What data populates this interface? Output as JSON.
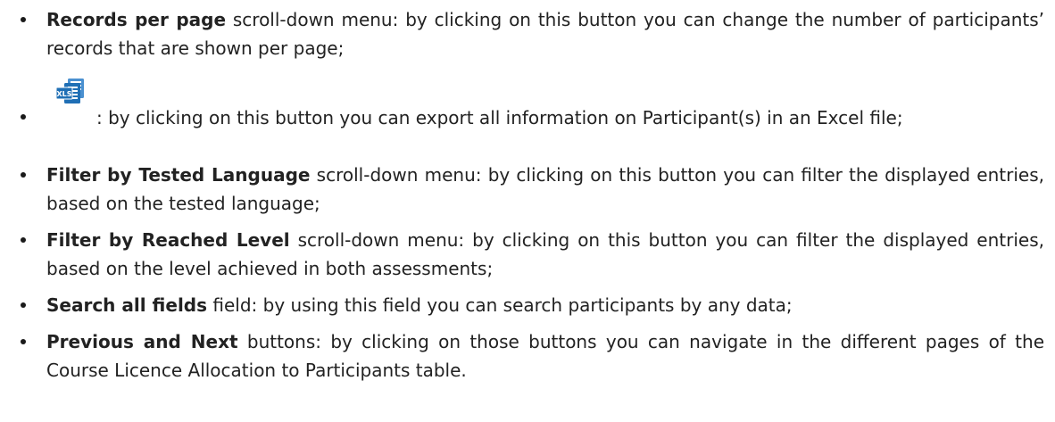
{
  "items": [
    {
      "bold": "Records per page",
      "text": " scroll-down menu: by clicking on this button you can change the number of participants’ records that are shown per page;"
    },
    {
      "bold": "",
      "text": ": by clicking on this button you can export all information on Participant(s) in an Excel file;",
      "icon": "xls-export-icon",
      "icon_label": "XLS"
    },
    {
      "bold": "Filter by Tested Language",
      "text": " scroll-down menu: by clicking on this button you can filter the displayed entries, based on the tested language;"
    },
    {
      "bold": "Filter by Reached Level",
      "text": " scroll-down menu: by clicking on this button you can filter the displayed entries, based on the level achieved in both assessments;"
    },
    {
      "bold": "Search all fields",
      "text": " field: by using this field you can search participants by any data;"
    },
    {
      "bold": "Previous and Next",
      "text": " buttons: by clicking on those buttons you can navigate in the different pages of the Course Licence Allocation to Participants table."
    }
  ],
  "colors": {
    "text": "#222222",
    "icon_primary": "#1f6fb5",
    "icon_secondary": "#4a90d0"
  }
}
